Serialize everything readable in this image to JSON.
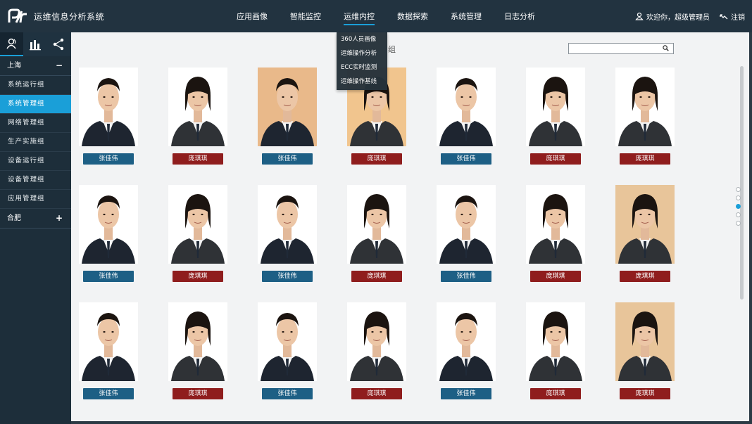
{
  "app": {
    "title": "运维信息分析系统"
  },
  "nav": {
    "items": [
      {
        "label": "应用画像"
      },
      {
        "label": "智能监控"
      },
      {
        "label": "运维内控",
        "active": true
      },
      {
        "label": "数据探索"
      },
      {
        "label": "系统管理"
      },
      {
        "label": "日志分析"
      }
    ]
  },
  "user": {
    "greeting": "欢迎你，超级管理员",
    "logout": "注销"
  },
  "dropdown": {
    "items": [
      "360人员画像",
      "运维操作分析",
      "ECC实时监测",
      "运维操作基线"
    ]
  },
  "sidebar": {
    "tabs": [
      {
        "icon": "person-icon"
      },
      {
        "icon": "bar-chart-icon"
      },
      {
        "icon": "share-network-icon"
      }
    ],
    "groups": [
      {
        "label": "上海",
        "sign": "−",
        "items": [
          "系统运行组",
          "系统管理组",
          "网络管理组",
          "生产实施组",
          "设备运行组",
          "设备管理组",
          "应用管理组"
        ],
        "active_index": 1
      },
      {
        "label": "合肥",
        "sign": "+"
      }
    ]
  },
  "main": {
    "section_title": "组",
    "search": {
      "placeholder": ""
    },
    "rows": [
      [
        {
          "name": "张佳伟",
          "tag": "blue"
        },
        {
          "name": "庞琪琪",
          "tag": "red"
        },
        {
          "name": "张佳伟",
          "tag": "blue"
        },
        {
          "name": "庞琪琪",
          "tag": "red"
        },
        {
          "name": "张佳伟",
          "tag": "blue"
        },
        {
          "name": "庞琪琪",
          "tag": "red"
        },
        {
          "name": "庞琪琪",
          "tag": "red"
        }
      ],
      [
        {
          "name": "张佳伟",
          "tag": "blue"
        },
        {
          "name": "庞琪琪",
          "tag": "red"
        },
        {
          "name": "张佳伟",
          "tag": "blue"
        },
        {
          "name": "庞琪琪",
          "tag": "red"
        },
        {
          "name": "张佳伟",
          "tag": "blue"
        },
        {
          "name": "庞琪琪",
          "tag": "red"
        },
        {
          "name": "庞琪琪",
          "tag": "red"
        }
      ],
      [
        {
          "name": "张佳伟",
          "tag": "blue"
        },
        {
          "name": "庞琪琪",
          "tag": "red"
        },
        {
          "name": "张佳伟",
          "tag": "blue"
        },
        {
          "name": "庞琪琪",
          "tag": "red"
        },
        {
          "name": "张佳伟",
          "tag": "blue"
        },
        {
          "name": "庞琪琪",
          "tag": "red"
        },
        {
          "name": "庞琪琪",
          "tag": "red"
        }
      ]
    ]
  },
  "colors": {
    "accent": "#1a9fd8",
    "topbar": "#223340",
    "sidebar": "#1d2e3a",
    "blue_tag": "#1d5f85",
    "red_tag": "#8f1d1d"
  }
}
